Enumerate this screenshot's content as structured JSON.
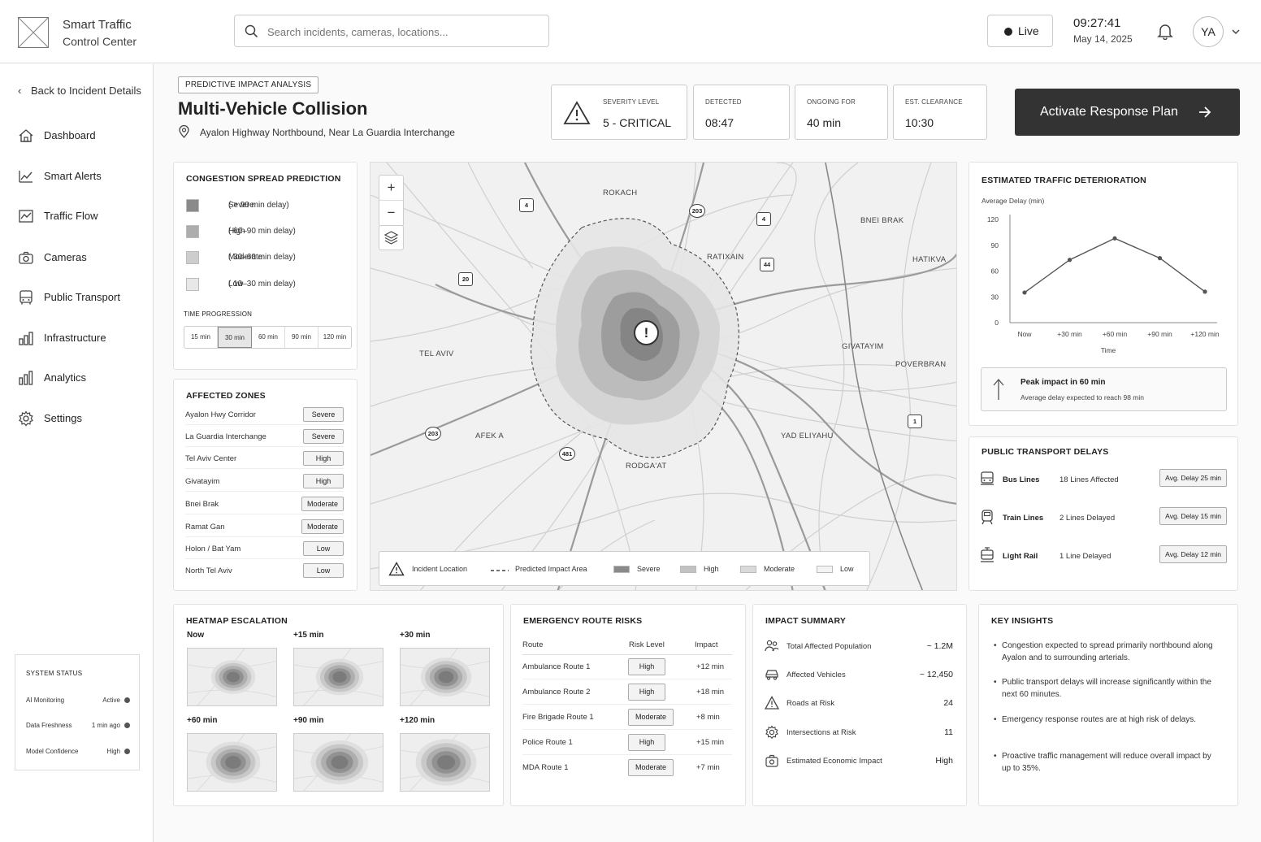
{
  "app": {
    "title_line1": "Smart Traffic",
    "title_line2": "Control Center"
  },
  "search": {
    "placeholder": "Search incidents, cameras, locations..."
  },
  "status": {
    "live_label": "Live",
    "time": "09:27:41",
    "date": "May 14, 2025",
    "user_initials": "YA"
  },
  "sidebar": {
    "back_label": "Back to Incident Details",
    "items": [
      {
        "label": "Dashboard",
        "icon": "home-icon"
      },
      {
        "label": "Smart Alerts",
        "icon": "trend-icon"
      },
      {
        "label": "Traffic Flow",
        "icon": "line-chart-icon"
      },
      {
        "label": "Cameras",
        "icon": "camera-icon"
      },
      {
        "label": "Public Transport",
        "icon": "bus-icon"
      },
      {
        "label": "Infrastructure",
        "icon": "infrastructure-icon"
      },
      {
        "label": "Analytics",
        "icon": "bar-chart-icon"
      },
      {
        "label": "Settings",
        "icon": "gear-icon"
      }
    ],
    "system_status": {
      "heading": "SYSTEM STATUS",
      "rows": [
        {
          "label": "AI Monitoring",
          "value": "Active"
        },
        {
          "label": "Data Freshness",
          "value": "1 min ago"
        },
        {
          "label": "Model Confidence",
          "value": "High"
        }
      ]
    }
  },
  "incident": {
    "tag": "PREDICTIVE IMPACT ANALYSIS",
    "title": "Multi-Vehicle Collision",
    "location": "Ayalon Highway Northbound, Near La Guardia Interchange",
    "stats": [
      {
        "label": "SEVERITY LEVEL",
        "value": "5 - CRITICAL"
      },
      {
        "label": "DETECTED",
        "value": "08:47"
      },
      {
        "label": "ONGOING FOR",
        "value": "40 min"
      },
      {
        "label": "EST. CLEARANCE",
        "value": "10:30"
      }
    ],
    "cta_label": "Activate Response Plan"
  },
  "congestion": {
    "heading": "CONGESTION SPREAD PREDICTION",
    "legend": [
      {
        "label": "Severe",
        "range": "( > 90 min delay)",
        "color": "#8a8a8a"
      },
      {
        "label": "High",
        "range": "( 60–90 min delay)",
        "color": "#adadad"
      },
      {
        "label": "Moderate",
        "range": "( 30–60 min delay)",
        "color": "#cdcdcd"
      },
      {
        "label": "Low",
        "range": "( 10–30 min delay)",
        "color": "#e8e8e8"
      }
    ],
    "time_label": "TIME PROGRESSION",
    "time_options": [
      "15 min",
      "30 min",
      "60 min",
      "90 min",
      "120 min"
    ],
    "time_selected": "30 min"
  },
  "zones": {
    "heading": "AFFECTED ZONES",
    "rows": [
      {
        "name": "Ayalon Hwy Corridor",
        "level": "Severe"
      },
      {
        "name": "La Guardia Interchange",
        "level": "Severe"
      },
      {
        "name": "Tel Aviv Center",
        "level": "High"
      },
      {
        "name": "Givatayim",
        "level": "High"
      },
      {
        "name": "Bnei Brak",
        "level": "Moderate"
      },
      {
        "name": "Ramat Gan",
        "level": "Moderate"
      },
      {
        "name": "Holon / Bat Yam",
        "level": "Low"
      },
      {
        "name": "North Tel Aviv",
        "level": "Low"
      }
    ]
  },
  "map": {
    "areas": [
      "ROKACH",
      "BNEI BRAK",
      "RATIXAIN",
      "HATIKVA",
      "TEL AVIV",
      "GIVATAYIM",
      "POVERBRAN",
      "AFEK A",
      "YAD ELIYAHU",
      "RODGA'AT"
    ],
    "shields": [
      "4",
      "20",
      "4",
      "44",
      "1",
      "481",
      "20"
    ],
    "shield_upper": "203",
    "shield_lower": "203",
    "incident_symbol": "!",
    "legend": {
      "incident": "Incident Location",
      "predicted": "Predicted Impact Area",
      "severe": "Severe",
      "high": "High",
      "moderate": "Moderate",
      "low": "Low"
    }
  },
  "deterioration": {
    "heading": "ESTIMATED TRAFFIC DETERIORATION",
    "note_title": "Peak impact in 60 min",
    "note_text": "Average delay expected to reach 98 min"
  },
  "chart_data": {
    "type": "line",
    "title": "",
    "ylabel": "Average Delay (min)",
    "xlabel": "Time",
    "categories": [
      "Now",
      "+30 min",
      "+60 min",
      "+90 min",
      "+120 min"
    ],
    "values": [
      35,
      73,
      98,
      75,
      36
    ],
    "ylim": [
      0,
      120
    ],
    "yticks": [
      0,
      30,
      60,
      90,
      120
    ],
    "grid": false
  },
  "transport": {
    "heading": "PUBLIC TRANSPORT DELAYS",
    "rows": [
      {
        "name": "Bus Lines",
        "status": "18 Lines Affected",
        "delay": "Avg. Delay 25 min"
      },
      {
        "name": "Train Lines",
        "status": "2 Lines Delayed",
        "delay": "Avg. Delay 15 min"
      },
      {
        "name": "Light Rail",
        "status": "1 Line Delayed",
        "delay": "Avg. Delay 12 min"
      }
    ]
  },
  "heatmap": {
    "heading": "HEATMAP ESCALATION",
    "steps": [
      "Now",
      "+15 min",
      "+30 min",
      "+60 min",
      "+90 min",
      "+120 min"
    ]
  },
  "routes": {
    "heading": "EMERGENCY ROUTE RISKS",
    "columns": [
      "Route",
      "Risk Level",
      "Impact"
    ],
    "rows": [
      {
        "route": "Ambulance Route 1",
        "risk": "High",
        "impact": "+12 min"
      },
      {
        "route": "Ambulance Route 2",
        "risk": "High",
        "impact": "+18 min"
      },
      {
        "route": "Fire Brigade Route 1",
        "risk": "Moderate",
        "impact": "+8 min"
      },
      {
        "route": "Police Route 1",
        "risk": "High",
        "impact": "+15 min"
      },
      {
        "route": "MDA Route 1",
        "risk": "Moderate",
        "impact": "+7 min"
      }
    ]
  },
  "impact": {
    "heading": "IMPACT SUMMARY",
    "rows": [
      {
        "label": "Total Affected Population",
        "value": "~ 1.2M"
      },
      {
        "label": "Affected Vehicles",
        "value": "~ 12,450"
      },
      {
        "label": "Roads at Risk",
        "value": "24"
      },
      {
        "label": "Intersections at Risk",
        "value": "11"
      },
      {
        "label": "Estimated Economic Impact",
        "value": "High"
      }
    ]
  },
  "insights": {
    "heading": "KEY INSIGHTS",
    "items": [
      "Congestion expected to spread primarily northbound along Ayalon and to surrounding arterials.",
      "Public transport delays will increase significantly within the next 60 minutes.",
      "Emergency response routes are at high risk of delays.",
      "Proactive traffic management will reduce overall impact by up to 35%."
    ]
  }
}
